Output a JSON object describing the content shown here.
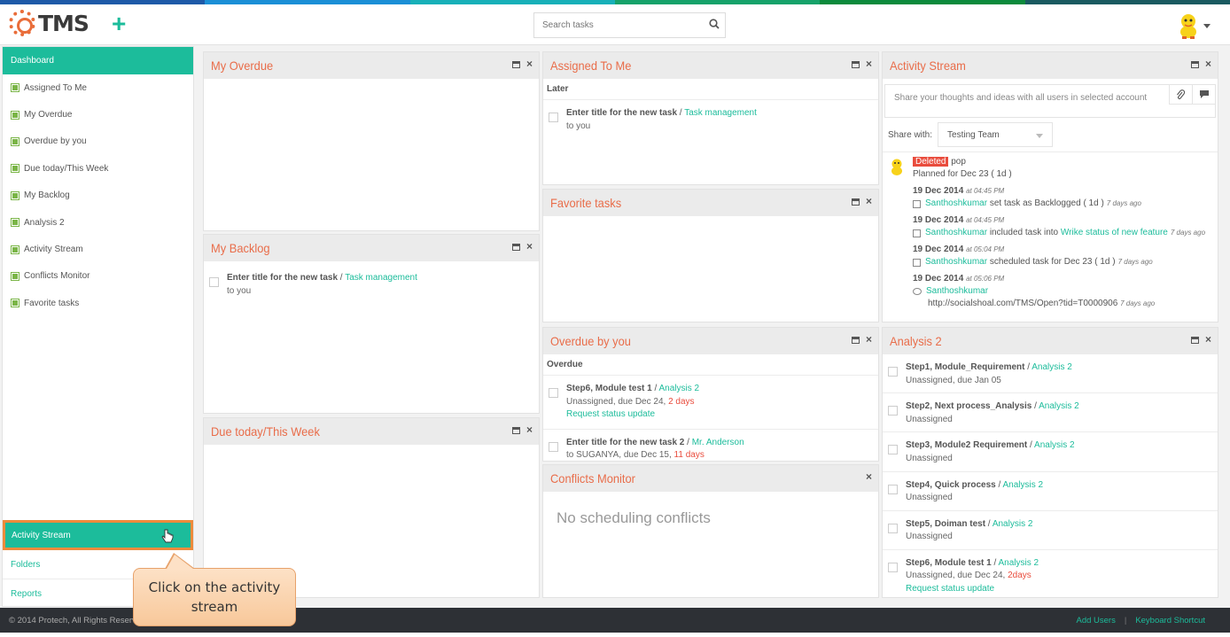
{
  "colors": {
    "accent": "#1cbc9b",
    "title": "#e96d4a",
    "danger": "#e94c3d",
    "strip": [
      "#1e5aa8",
      "#1b8fd6",
      "#18b0b8",
      "#16a26a",
      "#0c8a3c",
      "#1a5a60"
    ]
  },
  "header": {
    "logo_text": "TMS",
    "add_label": "+",
    "search_placeholder": "Search tasks"
  },
  "sidebar": {
    "active": "Dashboard",
    "items": [
      "Assigned To Me",
      "My Overdue",
      "Overdue by you",
      "Due today/This Week",
      "My Backlog",
      "Analysis 2",
      "Activity Stream",
      "Conflicts Monitor",
      "Favorite tasks"
    ],
    "bottom": {
      "activity": "Activity Stream",
      "folders": "Folders",
      "reports": "Reports"
    }
  },
  "callout": {
    "line1": "Click on the activity",
    "line2": "stream"
  },
  "widgets": {
    "my_overdue": {
      "title": "My Overdue"
    },
    "my_backlog": {
      "title": "My Backlog",
      "task": {
        "name": "Enter title for the new task",
        "project": "Task management",
        "sub": "to you"
      }
    },
    "due_today": {
      "title": "Due today/This Week"
    },
    "assigned": {
      "title": "Assigned To Me",
      "group": "Later",
      "task": {
        "name": "Enter title for the new task",
        "project": "Task management",
        "sub": "to you"
      }
    },
    "favorite": {
      "title": "Favorite tasks"
    },
    "overdue_by_you": {
      "title": "Overdue by you",
      "group": "Overdue",
      "tasks": [
        {
          "name": "Step6, Module test 1",
          "project": "Analysis 2",
          "sub": "Unassigned, due Dec 24, ",
          "late": "2 days",
          "action": "Request status update"
        },
        {
          "name": "Enter title for the new task 2",
          "project": "Mr. Anderson",
          "sub": "to SUGANYA, due Dec 15, ",
          "late": "11 days"
        }
      ]
    },
    "conflicts": {
      "title": "Conflicts Monitor",
      "empty": "No scheduling conflicts"
    },
    "activity": {
      "title": "Activity Stream",
      "share_placeholder": "Share your thoughts and ideas with all users in selected account",
      "share_with_label": "Share with:",
      "share_with_value": "Testing Team",
      "entry": {
        "badge": "Deleted",
        "name": "pop",
        "planned": "Planned for Dec 23 ( 1d )",
        "events": [
          {
            "date": "19 Dec 2014",
            "time": "at 04:45 PM",
            "user": "Santhoshkumar",
            "text": "set task as Backlogged ( 1d )",
            "ago": "7 days ago"
          },
          {
            "date": "19 Dec 2014",
            "time": "at 04:45 PM",
            "user": "Santhoshkumar",
            "text": "included task into",
            "link": "Wrike status of new feature",
            "ago": "7 days ago"
          },
          {
            "date": "19 Dec 2014",
            "time": "at 05:04 PM",
            "user": "Santhoshkumar",
            "text": "scheduled task for Dec 23 ( 1d )",
            "ago": "7 days ago"
          },
          {
            "date": "19 Dec 2014",
            "time": "at 05:06 PM",
            "user": "Santhoshkumar",
            "text": "http://socialshoal.com/TMS/Open?tid=T0000906",
            "ago": "7 days ago"
          }
        ]
      }
    },
    "analysis": {
      "title": "Analysis 2",
      "tasks": [
        {
          "name": "Step1, Module_Requirement",
          "project": "Analysis 2",
          "sub": "Unassigned, due Jan 05"
        },
        {
          "name": "Step2, Next process_Analysis",
          "project": "Analysis 2",
          "sub": "Unassigned"
        },
        {
          "name": "Step3, Module2 Requirement",
          "project": "Analysis 2",
          "sub": "Unassigned"
        },
        {
          "name": "Step4, Quick process",
          "project": "Analysis 2",
          "sub": "Unassigned"
        },
        {
          "name": "Step5, Doiman test",
          "project": "Analysis 2",
          "sub": "Unassigned"
        },
        {
          "name": "Step6, Module test 1",
          "project": "Analysis 2",
          "sub": "Unassigned, due Dec 24, ",
          "late": "2days",
          "action": "Request status update"
        }
      ]
    }
  },
  "footer": {
    "copyright": "© 2014 Protech, All Rights Reserved",
    "add_users": "Add Users",
    "sep": "|",
    "shortcut": "Keyboard Shortcut"
  }
}
